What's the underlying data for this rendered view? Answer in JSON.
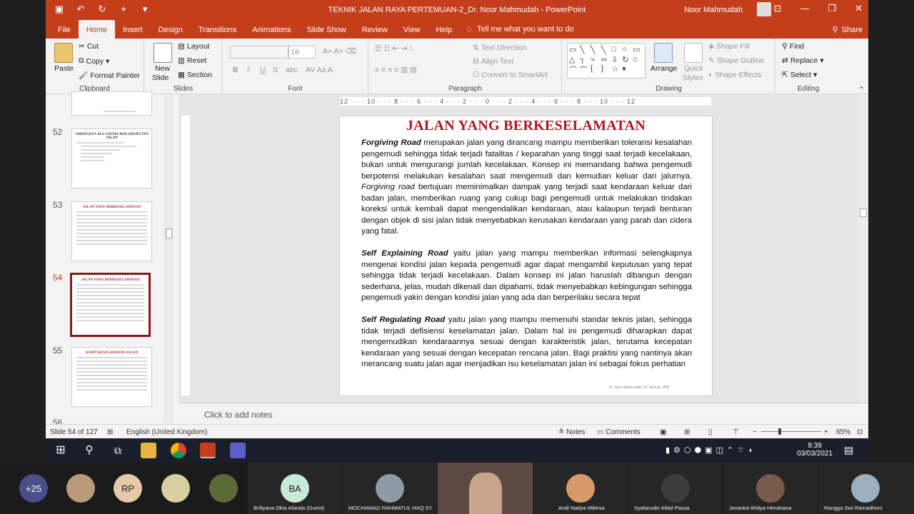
{
  "titlebar": {
    "doc_title": "TEKNIK JALAN RAYA PERTEMUAN-2_Dr. Noor Mahmudah  -  PowerPoint",
    "user": "Noor Mahmudah",
    "qat": [
      "save-icon",
      "undo-icon",
      "redo-icon",
      "touch-mode-icon",
      "customize-icon"
    ]
  },
  "tabs": [
    "File",
    "Home",
    "Insert",
    "Design",
    "Transitions",
    "Animations",
    "Slide Show",
    "Review",
    "View",
    "Help"
  ],
  "tell_me": "Tell me what you want to do",
  "share": "Share",
  "ribbon": {
    "clipboard": {
      "label": "Clipboard",
      "paste": "Paste",
      "cut": "Cut",
      "copy": "Copy",
      "format_painter": "Format Painter"
    },
    "slides": {
      "label": "Slides",
      "new_slide_1": "New",
      "new_slide_2": "Slide",
      "layout": "Layout",
      "reset": "Reset",
      "section": "Section"
    },
    "font": {
      "label": "Font",
      "size": "18",
      "bold": "B",
      "italic": "I",
      "underline": "U",
      "strike": "S",
      "abc": "abc"
    },
    "paragraph": {
      "label": "Paragraph",
      "text_direction": "Text Direction",
      "align_text": "Align Text",
      "smartart": "Convert to SmartArt"
    },
    "drawing": {
      "label": "Drawing",
      "arrange": "Arrange",
      "quick_styles_1": "Quick",
      "quick_styles_2": "Styles",
      "shape_fill": "Shape Fill",
      "shape_outline": "Shape Outline",
      "shape_effects": "Shape Effects"
    },
    "editing": {
      "label": "Editing",
      "find": "Find",
      "replace": "Replace",
      "select": "Select"
    }
  },
  "thumbnails": [
    {
      "num": "52",
      "title": "JARINGAN LALU LINTAS DAN ANGKUTAN JALAN"
    },
    {
      "num": "53",
      "title": "JALAN YANG BERKESELAMATAN"
    },
    {
      "num": "54",
      "title": "JALAN YANG BERKESELAMATAN"
    },
    {
      "num": "55",
      "title": "AUDIT KESELAMATAN JALAN"
    },
    {
      "num": "56",
      "title": ""
    }
  ],
  "ruler": "12 · · · 10 · · · 8 · · · 6 · · · 4 · · · 2 · · · 0 · · · 2 · · · 4 · · · 6 · · · 8 · · · 10 · · · 12",
  "slide": {
    "title": "JALAN YANG BERKESELAMATAN",
    "p1_term": "Forgiving Road",
    "p1_a": " merupakan jalan yang dirancang mampu memberikan toleransi kesalahan pengemudi sehingga tidak terjadi fatalitas / keparahan yang tinggi saat terjadi kecelakaan, bukan untuk mengurangi jumlah kecelakaan. Konsep ini memandang bahwa pengemudi berpotensi melakukan kesalahan saat mengemudi dan kemudian keluar dari jalurnya. ",
    "p1_term2": "Forgiving road",
    "p1_b": " bertujuan meminimalkan dampak yang terjadi saat kendaraan keluar dari badan jalan, memberikan ruang yang cukup bagi pengemudi untuk melakukan tindakan koreksi untuk kembali dapat mengendalikan kendaraan, atau kalaupun terjadi benturan dengan objek di sisi jalan tidak menyebabkan kerusakan kendaraan yang parah dan cidera yang fatal.",
    "p2_term": "Self Explaining Road",
    "p2": " yaitu jalan yang mampu memberikan informasi selengkapnya mengenai kondisi jalan kepada pengemudi agar dapat mengambil keputusan yang tepat sehingga tidak terjadi kecelakaan. Dalam konsep ini jalan haruslah dibangun dengan sederhana, jelas, mudah dikenali dan dipahami, tidak menyebabkan kebingungan sehingga pengemudi yakin dengan kondisi jalan yang ada dan berperilaku secara tepat",
    "p3_term": "Self Regulating Road",
    "p3": " yaitu jalan yang mampu memenuhi standar teknis jalan, sehingga tidak terjadi defisiensi keselamatan jalan. Dalam hal ini pengemudi diharapkan dapat mengemudikan kendaraannya sesuai dengan karakteristik jalan, terutama kecepatan kendaraan yang sesuai dengan kecepatan rencana jalan. Bagi praktisi yang nantinya akan merancang suatu jalan agar menjadikan isu keselamatan jalan ini sebagai fokus perhatian",
    "footer": "Dr. Noor Mahmudah, ST, M.Eng., IPM"
  },
  "notes_placeholder": "Click to add notes",
  "status": {
    "slide": "Slide 54 of 127",
    "language": "English (United Kingdom)",
    "notes": "Notes",
    "comments": "Comments",
    "zoom": "65%"
  },
  "taskbar": {
    "time": "9:39",
    "date": "03/03/2021"
  },
  "meeting": {
    "more": "+25",
    "initials_rp": "RP",
    "initials_ba": "BA",
    "names": [
      "Brillyana Okta Afanda (Guest)",
      "MOCHAMAD RAHMATUL HAQ SY",
      "Andi Nadya Milenia",
      "Syafarudin Afdal Passa",
      "Jovanka Widya Hendriana",
      "Rangga Dwi Ramadhoni"
    ]
  }
}
